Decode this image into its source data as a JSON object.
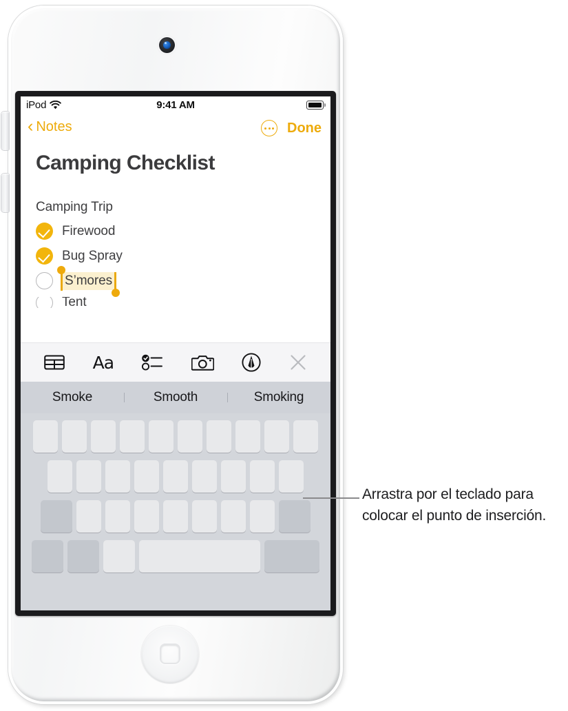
{
  "device": {
    "name": "ipod-touch",
    "camera_icon": "camera-icon",
    "home_button_icon": "home-button-icon",
    "volume_up_icon": "volume-up-button",
    "volume_down_icon": "volume-down-button"
  },
  "status_bar": {
    "carrier": "iPod",
    "wifi_icon": "wifi-icon",
    "time": "9:41 AM",
    "battery_icon": "battery-full-icon"
  },
  "nav_bar": {
    "back_chevron": "‹",
    "back_label": "Notes",
    "more_icon": "ellipsis-circle-icon",
    "done_label": "Done"
  },
  "note": {
    "title": "Camping Checklist",
    "section_label": "Camping Trip",
    "items": [
      {
        "label": "Firewood",
        "checked": true
      },
      {
        "label": "Bug Spray",
        "checked": true
      },
      {
        "label": "S’mores",
        "checked": false,
        "selected": true
      },
      {
        "label": "Tent",
        "checked": false,
        "clipped": true
      }
    ]
  },
  "format_toolbar": {
    "items": [
      {
        "name": "table-icon",
        "label": "Table"
      },
      {
        "name": "text-format-icon",
        "label": "Aa"
      },
      {
        "name": "checklist-icon",
        "label": "Checklist"
      },
      {
        "name": "camera-icon",
        "label": "Camera"
      },
      {
        "name": "markup-pen-icon",
        "label": "Markup"
      },
      {
        "name": "close-icon",
        "label": "Close"
      }
    ]
  },
  "predictive_bar": {
    "suggestions": [
      "Smoke",
      "Smooth",
      "Smoking"
    ]
  },
  "keyboard": {
    "state": "trackpad-mode-blank",
    "rows": [
      10,
      9,
      9,
      5
    ]
  },
  "callout": {
    "text": "Arrastra por el teclado para colocar el punto de inserción."
  },
  "colors": {
    "accent": "#edab0c",
    "checkbox_filled": "#f2b50c",
    "selection_highlight": "#fbf0cf",
    "selection_handle": "#eeaa0c",
    "keyboard_bg": "#d3d6db",
    "key_light": "#e8e9eb",
    "key_dark": "#c3c7cd",
    "predictive_bg": "#cfd2d8",
    "toolbar_bg": "#f5f5f7",
    "text_primary": "#3e3e40"
  }
}
